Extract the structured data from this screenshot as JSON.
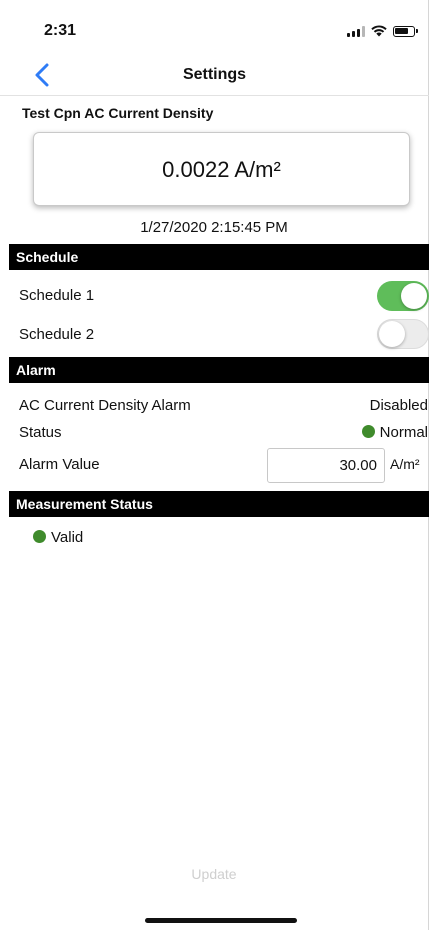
{
  "status_bar": {
    "time": "2:31"
  },
  "nav": {
    "title": "Settings"
  },
  "test_point": {
    "label": "Test Cpn AC Current Density",
    "value": "0.0022 A/m²",
    "timestamp": "1/27/2020 2:15:45 PM"
  },
  "schedule": {
    "header": "Schedule",
    "items": [
      {
        "label": "Schedule 1",
        "enabled": true
      },
      {
        "label": "Schedule 2",
        "enabled": false
      }
    ]
  },
  "alarm": {
    "header": "Alarm",
    "ac_label": "AC Current Density Alarm",
    "ac_value": "Disabled",
    "status_label": "Status",
    "status_value": "Normal",
    "status_color": "#3f8b2c",
    "alarm_value_label": "Alarm Value",
    "alarm_value": "30.00",
    "unit": "A/m²"
  },
  "measurement": {
    "header": "Measurement Status",
    "status": "Valid",
    "status_color": "#3f8b2c"
  },
  "footer": {
    "update_label": "Update"
  },
  "colors": {
    "toggle_on": "#5fbd5a",
    "accent": "#2f7cf6"
  }
}
